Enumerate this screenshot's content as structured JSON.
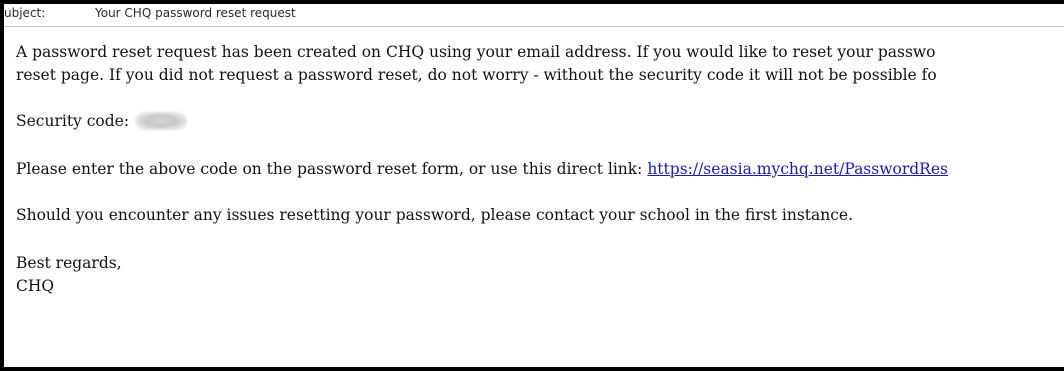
{
  "header": {
    "label": "ubject:",
    "subject": "Your CHQ password reset request"
  },
  "email": {
    "para1_line1": "A password reset request has been created on CHQ using your email address. If you would like to reset your passwo",
    "para1_line2": "reset page. If you did not request a password reset, do not worry - without the security code it will not be possible fo",
    "security_label": "Security code:",
    "link_intro": "Please enter the above code on the password reset form, or use this direct link: ",
    "link_text": "https://seasia.mychq.net/PasswordRes",
    "issues": "Should you encounter any issues resetting your password, please contact your school in the first instance.",
    "signoff": "Best regards,",
    "sender": "CHQ"
  }
}
